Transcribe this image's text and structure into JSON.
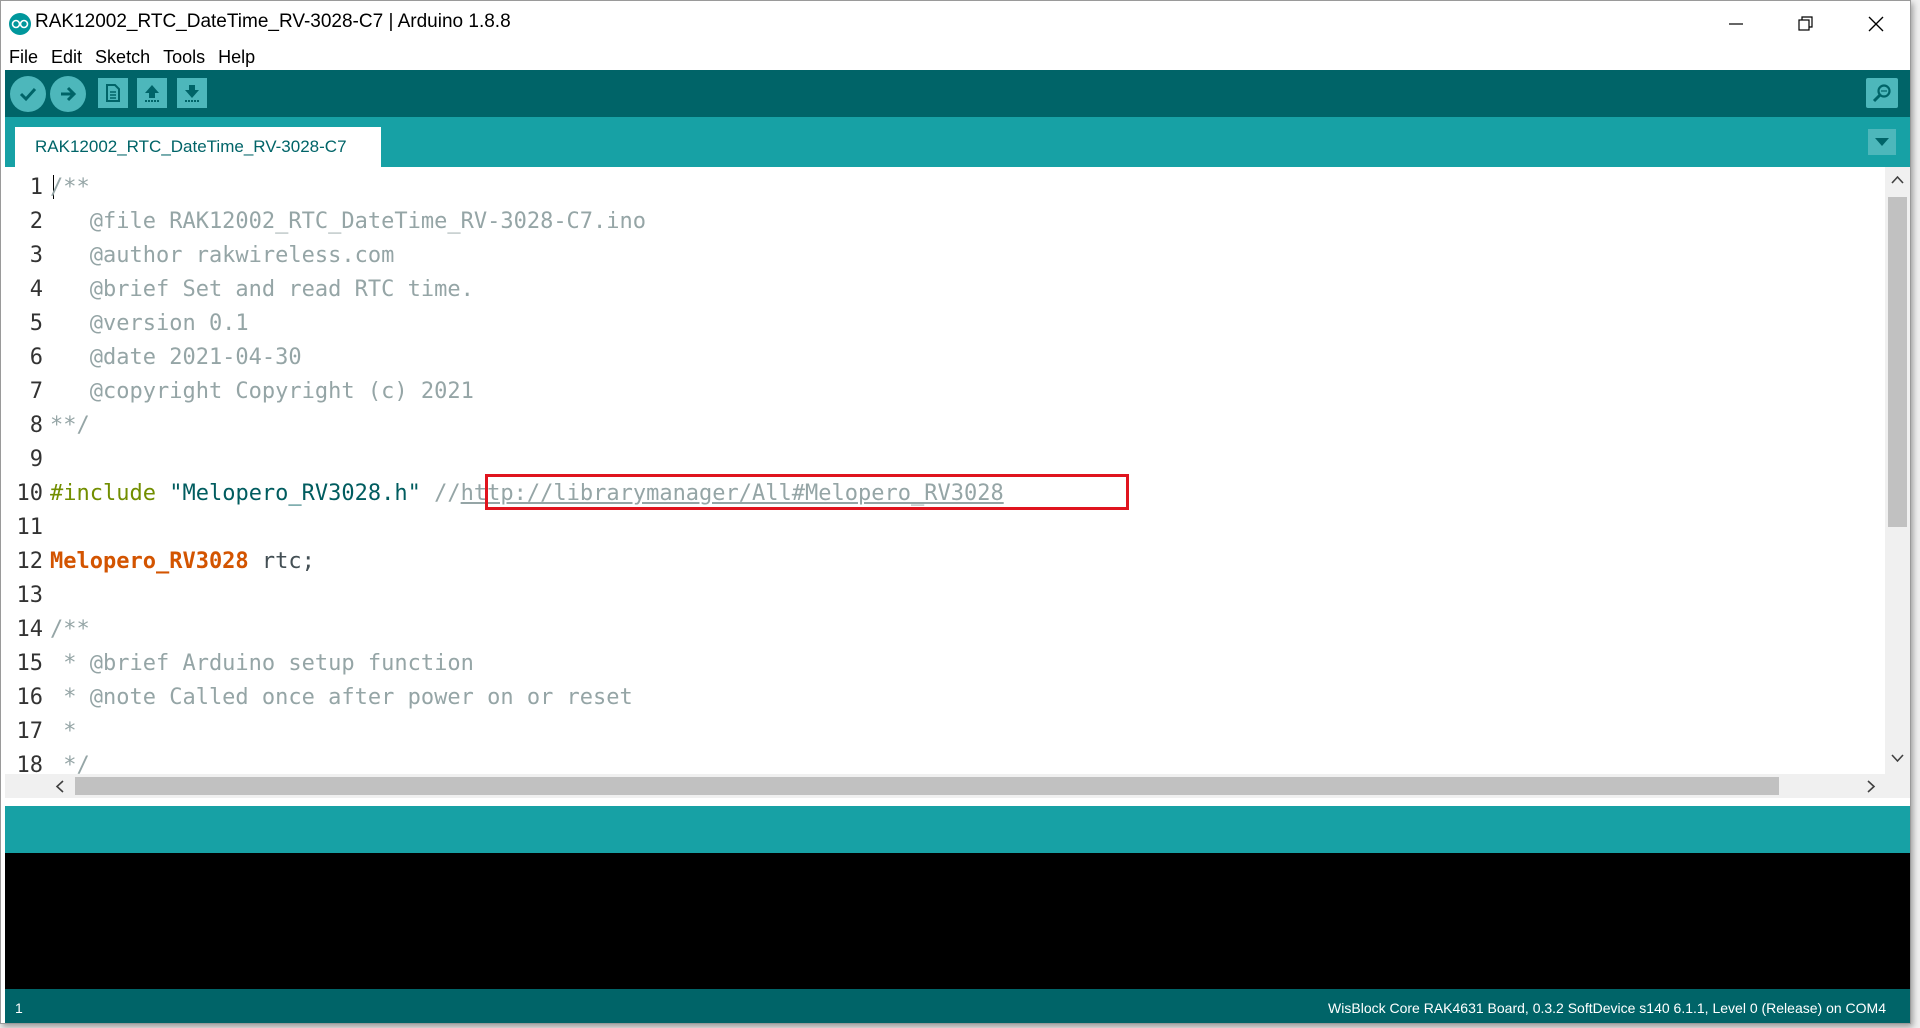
{
  "window": {
    "title": "RAK12002_RTC_DateTime_RV-3028-C7 | Arduino 1.8.8"
  },
  "menu": {
    "items": [
      "File",
      "Edit",
      "Sketch",
      "Tools",
      "Help"
    ]
  },
  "toolbar": {
    "buttons": [
      "verify",
      "upload",
      "new",
      "open",
      "save",
      "serial-monitor"
    ]
  },
  "tab": {
    "label": "RAK12002_RTC_DateTime_RV-3028-C7"
  },
  "editor": {
    "line_numbers": [
      "1",
      "2",
      "3",
      "4",
      "5",
      "6",
      "7",
      "8",
      "9",
      "10",
      "11",
      "12",
      "13",
      "14",
      "15",
      "16",
      "17",
      "18"
    ],
    "lines": {
      "l1": "/**",
      "l2": "   @file RAK12002_RTC_DateTime_RV-3028-C7.ino",
      "l3": "   @author rakwireless.com",
      "l4": "   @brief Set and read RTC time.",
      "l5": "   @version 0.1",
      "l6": "   @date 2021-04-30",
      "l7": "   @copyright Copyright (c) 2021",
      "l8": "**/",
      "l10_include": "#include",
      "l10_string": "\"Melopero_RV3028.h\"",
      "l10_comment_prefix": "//",
      "l10_url": "http://librarymanager/All#Melopero_RV3028",
      "l12_type": "Melopero_RV3028",
      "l12_rest": " rtc;",
      "l14": "/**",
      "l15": " * @brief Arduino setup function",
      "l16": " * @note Called once after power on or reset",
      "l17": " *",
      "l18": " */"
    }
  },
  "footer": {
    "line_number": "1",
    "board_info": "WisBlock Core RAK4631 Board, 0.3.2 SoftDevice s140 6.1.1, Level 0 (Release) on COM4"
  },
  "colors": {
    "toolbar": "#006468",
    "tabbar": "#17a1a5",
    "highlight_box": "#e0141e"
  }
}
